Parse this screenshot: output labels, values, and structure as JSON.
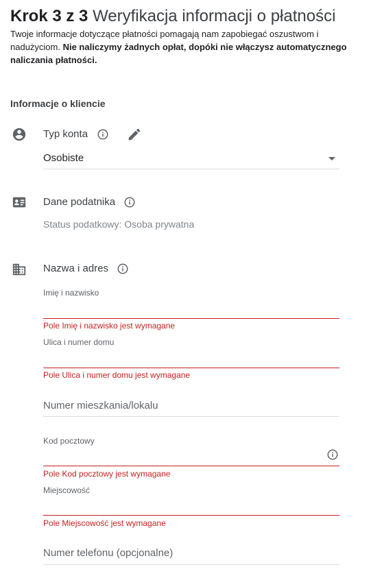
{
  "header": {
    "step": "Krok 3 z 3",
    "title": "Weryfikacja informacji o płatności",
    "intro_plain": "Twoje informacje dotyczące płatności pomagają nam zapobiegać oszustwom i nadużyciom. ",
    "intro_bold": "Nie naliczymy żadnych opłat, dopóki nie włączysz automatycznego naliczania płatności."
  },
  "section_title": "Informacje o kliencie",
  "account_type": {
    "label": "Typ konta",
    "value": "Osobiste"
  },
  "tax": {
    "label": "Dane podatnika",
    "status": "Status podatkowy: Osoba prywatna"
  },
  "address": {
    "label": "Nazwa i adres",
    "fields": {
      "name": {
        "label": "Imię i nazwisko",
        "error": "Pole Imię i nazwisko jest wymagane"
      },
      "street": {
        "label": "Ulica i numer domu",
        "error": "Pole Ulica i numer domu jest wymagane"
      },
      "apartment": {
        "placeholder": "Numer mieszkania/lokalu"
      },
      "postal": {
        "label": "Kod pocztowy",
        "error": "Pole Kod pocztowy jest wymagane"
      },
      "city": {
        "label": "Miejscowość",
        "error": "Pole Miejscowość jest wymagane"
      },
      "phone": {
        "placeholder": "Numer telefonu (opcjonalne)"
      }
    }
  },
  "colors": {
    "error": "#c5221f",
    "icon": "#5f6368",
    "divider": "#dadce0"
  },
  "icons": [
    "account-circle-icon",
    "info-icon",
    "edit-pencil-icon",
    "id-card-icon",
    "business-building-icon",
    "dropdown-arrow-icon"
  ]
}
